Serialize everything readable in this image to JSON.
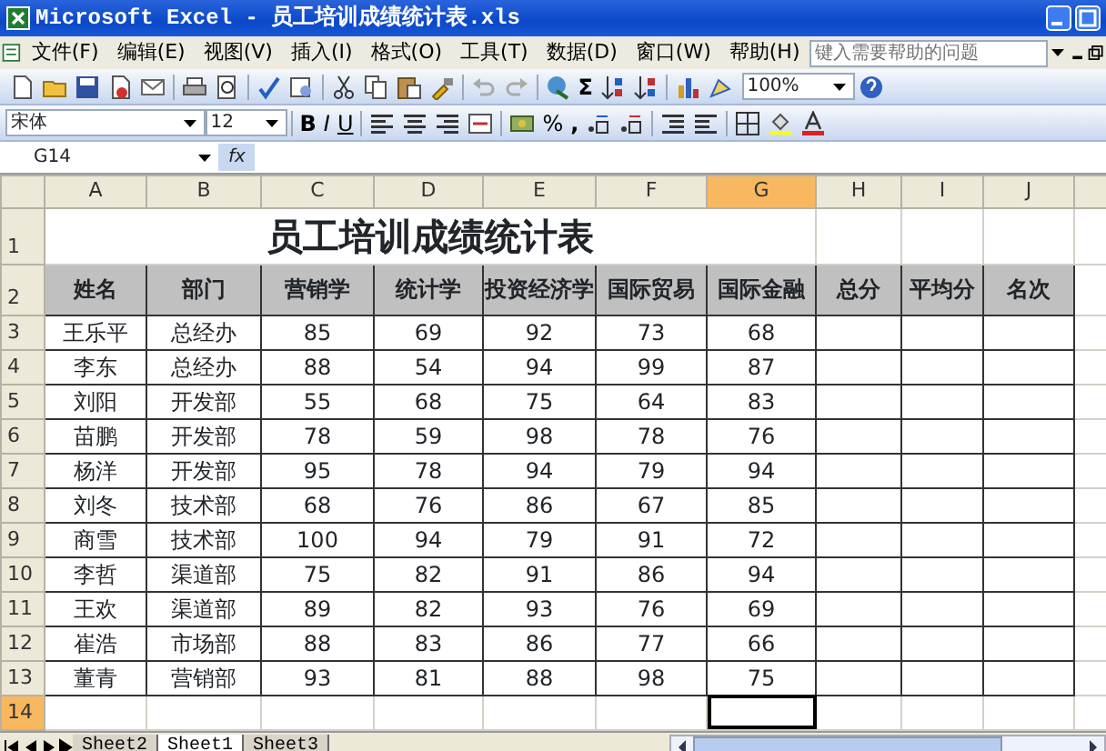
{
  "window": {
    "title": "Microsoft Excel - 员工培训成绩统计表.xls"
  },
  "menu_bar": {
    "items": [
      "文件(F)",
      "编辑(E)",
      "视图(V)",
      "插入(I)",
      "格式(O)",
      "工具(T)",
      "数据(D)",
      "窗口(W)",
      "帮助(H)"
    ],
    "help_box": {
      "placeholder": "键入需要帮助的问题"
    }
  },
  "standard_toolbar": {
    "sum": "Σ",
    "zoom": "100%"
  },
  "formatting_toolbar": {
    "font": "宋体",
    "size": "12",
    "bold": "B",
    "italic": "I",
    "underline": "U",
    "percent": "%",
    "comma": ","
  },
  "formula_bar": {
    "name_box": "G14",
    "fx": "fx"
  },
  "sheet": {
    "columns": [
      {
        "label": "A",
        "selected": false
      },
      {
        "label": "B",
        "selected": false
      },
      {
        "label": "C",
        "selected": false
      },
      {
        "label": "D",
        "selected": false
      },
      {
        "label": "E",
        "selected": false
      },
      {
        "label": "F",
        "selected": false
      },
      {
        "label": "G",
        "selected": true
      },
      {
        "label": "H",
        "selected": false
      },
      {
        "label": "I",
        "selected": false
      },
      {
        "label": "J",
        "selected": false
      }
    ],
    "rows": [
      {
        "label": "1",
        "selected": false
      },
      {
        "label": "2",
        "selected": false
      },
      {
        "label": "3",
        "selected": false
      },
      {
        "label": "4",
        "selected": false
      },
      {
        "label": "5",
        "selected": false
      },
      {
        "label": "6",
        "selected": false
      },
      {
        "label": "7",
        "selected": false
      },
      {
        "label": "8",
        "selected": false
      },
      {
        "label": "9",
        "selected": false
      },
      {
        "label": "10",
        "selected": false
      },
      {
        "label": "11",
        "selected": false
      },
      {
        "label": "12",
        "selected": false
      },
      {
        "label": "13",
        "selected": false
      },
      {
        "label": "14",
        "selected": true
      }
    ],
    "title": "员工培训成绩统计表",
    "headers": [
      "姓名",
      "部门",
      "营销学",
      "统计学",
      "投资经济学",
      "国际贸易",
      "国际金融",
      "总分",
      "平均分",
      "名次"
    ],
    "data": [
      [
        "王乐平",
        "总经办",
        "85",
        "69",
        "92",
        "73",
        "68"
      ],
      [
        "李东",
        "总经办",
        "88",
        "54",
        "94",
        "99",
        "87"
      ],
      [
        "刘阳",
        "开发部",
        "55",
        "68",
        "75",
        "64",
        "83"
      ],
      [
        "苗鹏",
        "开发部",
        "78",
        "59",
        "98",
        "78",
        "76"
      ],
      [
        "杨洋",
        "开发部",
        "95",
        "78",
        "94",
        "79",
        "94"
      ],
      [
        "刘冬",
        "技术部",
        "68",
        "76",
        "86",
        "67",
        "85"
      ],
      [
        "商雪",
        "技术部",
        "100",
        "94",
        "79",
        "91",
        "72"
      ],
      [
        "李哲",
        "渠道部",
        "75",
        "82",
        "91",
        "86",
        "94"
      ],
      [
        "王欢",
        "渠道部",
        "89",
        "82",
        "93",
        "76",
        "69"
      ],
      [
        "崔浩",
        "市场部",
        "88",
        "83",
        "86",
        "77",
        "66"
      ],
      [
        "董青",
        "营销部",
        "93",
        "81",
        "88",
        "98",
        "75"
      ]
    ]
  },
  "sheet_tabs": [
    {
      "label": "Sheet2",
      "selected": false
    },
    {
      "label": "Sheet1",
      "selected": true
    },
    {
      "label": "Sheet3",
      "selected": false
    }
  ]
}
